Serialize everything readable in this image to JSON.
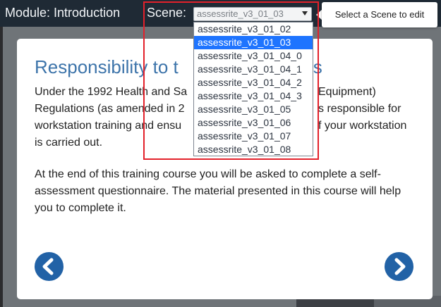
{
  "header": {
    "module_title": "Module: Introduction",
    "scene_label": "Scene:",
    "scene_selected": "assessrite_v3_01_03"
  },
  "tooltip": {
    "text": "Select a Scene to edit"
  },
  "dropdown": {
    "options": [
      "assessrite_v3_01_02",
      "assessrite_v3_01_03",
      "assessrite_v3_01_04_0",
      "assessrite_v3_01_04_1",
      "assessrite_v3_01_04_2",
      "assessrite_v3_01_04_3",
      "assessrite_v3_01_05",
      "assessrite_v3_01_06",
      "assessrite_v3_01_07",
      "assessrite_v3_01_08"
    ],
    "selected_index": 1
  },
  "card": {
    "title": "Responsibility to t",
    "title_tail": "ss",
    "para1_line1": "Under the 1992 Health and Sa",
    "para1_line1_tail": "Equipment)",
    "para1_line2": "Regulations (as amended in 2",
    "para1_line2_tail": "s responsible for",
    "para1_line3": "workstation training and ensu",
    "para1_line3_tail": "f your workstation",
    "para1_line4": "is carried out.",
    "para2": "At the end of this training course you will be asked to complete a self-assessment questionnaire. The material presented in this course will help you to complete it."
  },
  "nav": {
    "prev_icon": "chevron-left-icon",
    "next_icon": "chevron-right-icon"
  },
  "colors": {
    "header_bg": "#1f2a35",
    "title_blue": "#3d74aa",
    "nav_blue": "#2262a6",
    "selected_option": "#1e74ff",
    "highlight_red": "#e3212b"
  }
}
